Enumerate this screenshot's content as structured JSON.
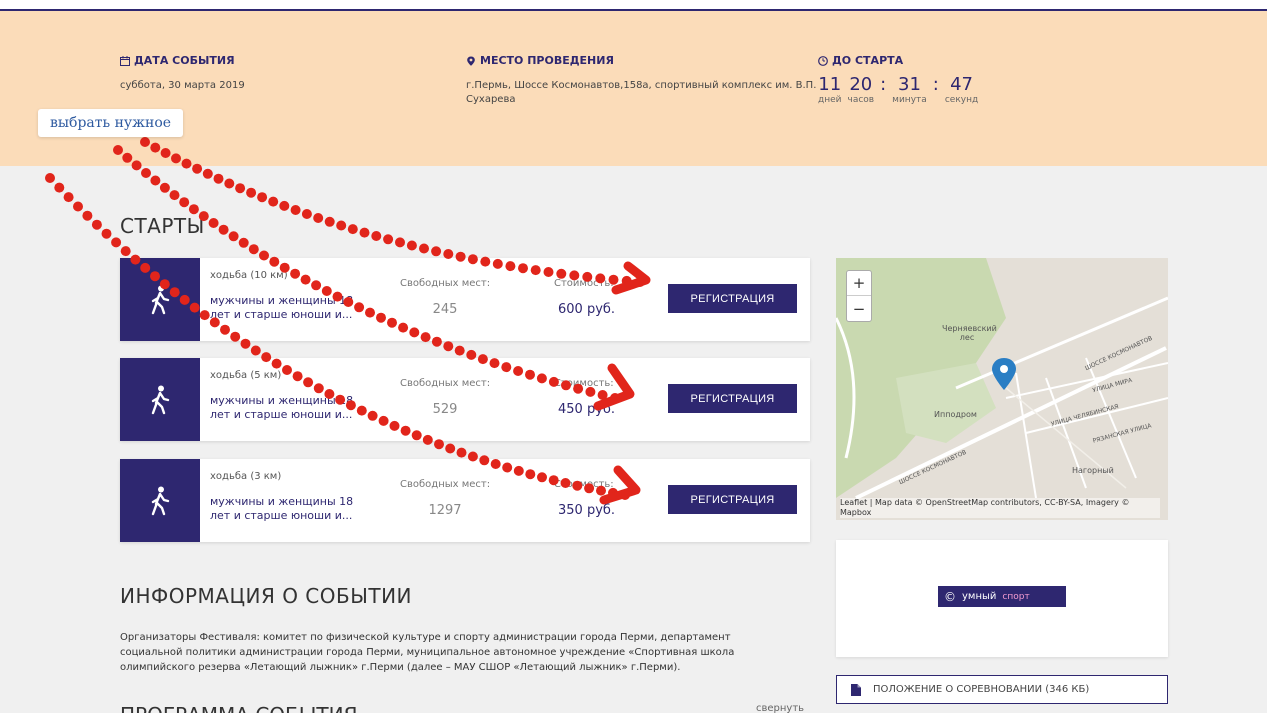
{
  "event": {
    "date_label": "ДАТА СОБЫТИЯ",
    "date_value": "суббота, 30 марта 2019",
    "place_label": "МЕСТО ПРОВЕДЕНИЯ",
    "place_value": "г.Пермь, Шоссе Космонавтов,158а, спортивный комплекс им. В.П. Сухарева",
    "start_label": "ДО СТАРТА",
    "countdown": {
      "days": "11",
      "days_lbl": "дней",
      "hours": "20",
      "hours_lbl": "часов",
      "minutes": "31",
      "minutes_lbl": "минута",
      "seconds": "47",
      "seconds_lbl": "секунд",
      "sep": ":"
    }
  },
  "tooltip": "выбрать нужное",
  "starts_title": "СТАРТЫ",
  "starts": [
    {
      "type": "ходьба (10 км)",
      "desc": "мужчины и женщины 18 лет и старше юноши и...",
      "free_label": "Свободных мест:",
      "free": "245",
      "price_label": "Стоимость:",
      "price": "600 руб.",
      "button": "РЕГИСТРАЦИЯ"
    },
    {
      "type": "ходьба (5 км)",
      "desc": "мужчины и женщины 18 лет и старше юноши и...",
      "free_label": "Свободных мест:",
      "free": "529",
      "price_label": "Стоимость:",
      "price": "450 руб.",
      "button": "РЕГИСТРАЦИЯ"
    },
    {
      "type": "ходьба (3 км)",
      "desc": "мужчины и женщины 18 лет и старше юноши и...",
      "free_label": "Свободных мест:",
      "free": "1297",
      "price_label": "Стоимость:",
      "price": "350 руб.",
      "button": "РЕГИСТРАЦИЯ"
    }
  ],
  "map": {
    "zoom_in": "+",
    "zoom_out": "−",
    "attribution": "Leaflet | Map data © OpenStreetMap contributors, CC-BY-SA, Imagery © Mapbox",
    "labels": {
      "forest": "Черняевский лес",
      "hippodrome": "Ипподром",
      "upland": "Нагорный",
      "highway": "ШОССЕ КОСМОНАВТОВ",
      "mira": "УЛИЦА МИРА",
      "tolmachev": "УЛИЦА ЧЕЛЯБИНСКАЯ",
      "ryazan": "РЯЗАНСКАЯ УЛИЦА",
      "highway2": "ШОССЕ КОСМОНАВТОВ"
    },
    "colors": {
      "bg": "#e4dfd7",
      "park": "#c9d9b0",
      "road": "#ffffff",
      "pin": "#2a7ec4"
    }
  },
  "logo": {
    "mark": "©",
    "text": "умный",
    "accent": "спорт"
  },
  "info_title": "ИНФОРМАЦИЯ О СОБЫТИИ",
  "info_text": "Организаторы Фестиваля: комитет по физической культуре и спорту администрации города Перми, департамент социальной политики администрации города Перми, муниципальное автономное учреждение «Спортивная школа олимпийского резерва «Летающий лыжник» г.Перми (далее – МАУ СШОР «Летающий лыжник» г.Перми).",
  "doc_link": "ПОЛОЖЕНИЕ О СОРЕВНОВАНИИ (346 КБ)",
  "program_title": "ПРОГРАММА СОБЫТИЯ",
  "program_side": "свернуть",
  "colors": {
    "primary": "#2e2770",
    "banner": "#fbdcb9",
    "annotation": "#e1251b"
  }
}
